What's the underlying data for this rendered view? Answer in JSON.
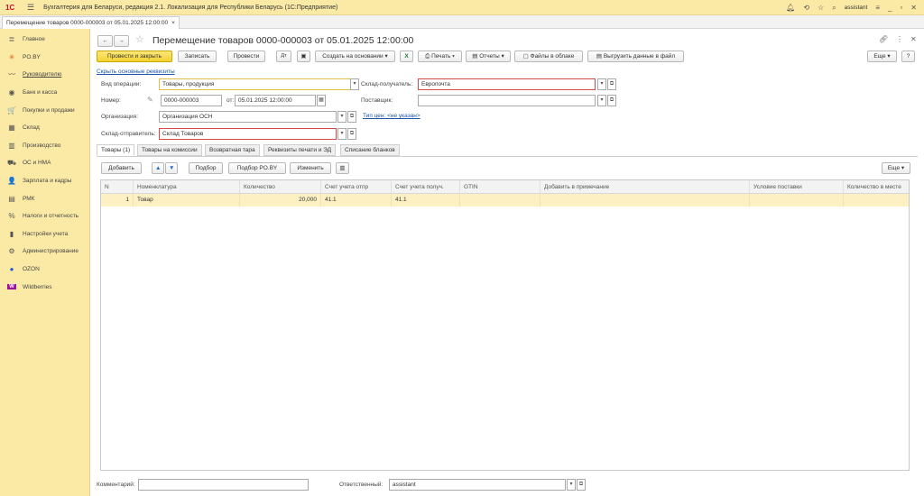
{
  "window": {
    "logo": "1С",
    "app_title": "Бухгалтерия для Беларуси, редакция 2.1. Локализация для Республики Беларусь  (1С:Предприятие)",
    "user": "assistant"
  },
  "open_tab": {
    "label": "Перемещение товаров 0000-000003 от 05.01.2025 12:00:00",
    "close": "×"
  },
  "sidebar": {
    "items": [
      {
        "label": "Главное",
        "icon": "menu-icon",
        "glyph": "≣"
      },
      {
        "label": "PO.BY",
        "icon": "sparkle-icon",
        "glyph": "✳"
      },
      {
        "label": "Руководителю",
        "icon": "chart-line-icon",
        "glyph": "〰"
      },
      {
        "label": "Банк и касса",
        "icon": "bank-icon",
        "glyph": "◉"
      },
      {
        "label": "Покупки и продажи",
        "icon": "cart-icon",
        "glyph": "🛒"
      },
      {
        "label": "Склад",
        "icon": "warehouse-icon",
        "glyph": "▦"
      },
      {
        "label": "Производство",
        "icon": "factory-icon",
        "glyph": "▥"
      },
      {
        "label": "ОС и НМА",
        "icon": "truck-icon",
        "glyph": "⛟"
      },
      {
        "label": "Зарплата и кадры",
        "icon": "person-icon",
        "glyph": "👤"
      },
      {
        "label": "РМК",
        "icon": "cash-register-icon",
        "glyph": "▤"
      },
      {
        "label": "Налоги и отчетность",
        "icon": "percent-icon",
        "glyph": "%"
      },
      {
        "label": "Настройки учета",
        "icon": "book-icon",
        "glyph": "▮"
      },
      {
        "label": "Администрирование",
        "icon": "gear-icon",
        "glyph": "⚙"
      },
      {
        "label": "OZON",
        "icon": "ozon-icon",
        "glyph": "●"
      },
      {
        "label": "Wildberries",
        "icon": "wildberries-icon",
        "glyph": "W"
      }
    ]
  },
  "form": {
    "title": "Перемещение товаров 0000-000003 от 05.01.2025 12:00:00",
    "toolbar": {
      "post_close": "Провести и закрыть",
      "save": "Записать",
      "post": "Провести",
      "create_based": "Создать на основании",
      "print": "Печать",
      "reports": "Отчеты",
      "cloud_files": "Файлы в облаке",
      "export": "Выгрузить данные в файл",
      "more": "Еще",
      "help": "?"
    },
    "hide_link": "Скрыть основные реквизиты",
    "op_type": {
      "label": "Вид операции:",
      "value": "Товары, продукция"
    },
    "number": {
      "label": "Номер:",
      "value": "0000-000003"
    },
    "date": {
      "label": "от:",
      "value": "05.01.2025 12:00:00"
    },
    "org": {
      "label": "Организация:",
      "value": "Организация ОСН"
    },
    "sender": {
      "label": "Склад-отправитель:",
      "value": "Склад Товаров"
    },
    "receiver": {
      "label": "Склад-получатель:",
      "value": "Европочта"
    },
    "supplier": {
      "label": "Поставщик:",
      "value": ""
    },
    "price_type_link": "Тип цен: <не указан>",
    "tabs": [
      "Товары (1)",
      "Товары на комиссии",
      "Возвратная тара",
      "Реквизиты печати и ЭД",
      "Списание бланков"
    ],
    "table_toolbar": {
      "add": "Добавить",
      "pick": "Подбор",
      "pick_poby": "Подбор PO.BY",
      "change": "Изменить",
      "more": "Еще"
    },
    "columns": [
      "N",
      "Номенклатура",
      "Количество",
      "Счет учета отпр",
      "Счет учета получ.",
      "GTIN",
      "Добавить в примечание",
      "Условие поставки",
      "Количество в месте"
    ],
    "rows": [
      {
        "n": "1",
        "item": "Товар",
        "qty": "20,000",
        "acc_from": "41.1",
        "acc_to": "41.1",
        "gtin": "",
        "note": "",
        "cond": "",
        "qty_place": ""
      }
    ],
    "comment": {
      "label": "Комментарий:",
      "value": ""
    },
    "responsible": {
      "label": "Ответственный:",
      "value": "assistant"
    }
  },
  "colors": {
    "panel": "#fbeaa5",
    "primary_button": "#f3d230",
    "selected_row": "#fdf1c4",
    "required_border": "#d24a4a"
  }
}
